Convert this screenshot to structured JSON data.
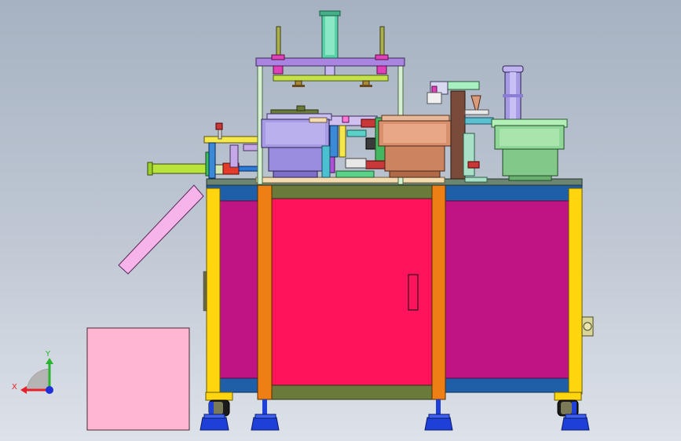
{
  "viewport": {
    "background_top": "#a6b2c2",
    "background_bottom": "#dde2e9"
  },
  "triad": {
    "x_label": "X",
    "y_label": "Y",
    "x_color": "#e8202a",
    "y_color": "#29b42f",
    "z_color": "#2030d8"
  },
  "colors": {
    "cabinet_panel": "#bf1584",
    "cabinet_door": "#ff145c",
    "frame_yellow": "#ffd60d",
    "frame_orange": "#ee7f14",
    "rail_blue": "#1f5fa8",
    "bowl_lavender": "#a79be6",
    "bowl_copper": "#d9906c",
    "bowl_green": "#8fd796",
    "carton_pink": "#ffb6d2",
    "chute_pink": "#f7b4ea",
    "plate_purple": "#a984e0",
    "feet_blue": "#1e40d8"
  }
}
